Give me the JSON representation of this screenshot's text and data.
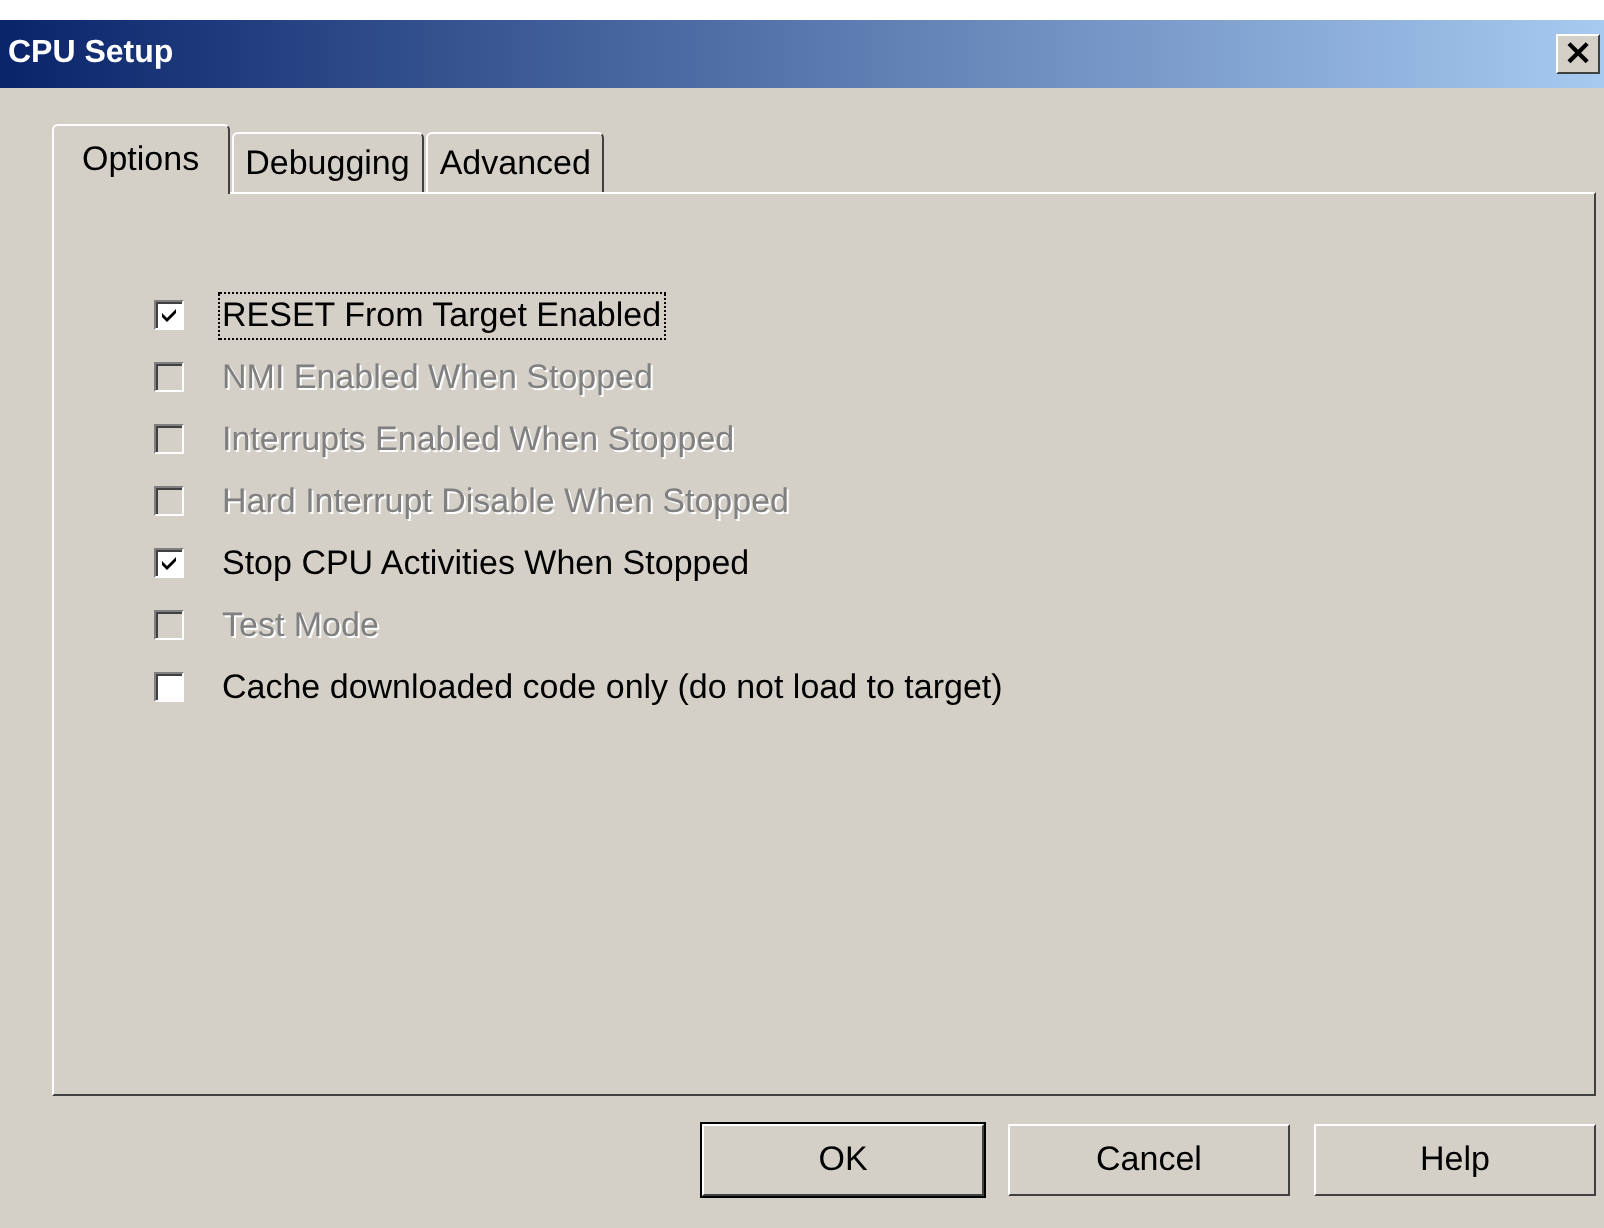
{
  "window": {
    "title": "CPU Setup",
    "close": "×"
  },
  "tabs": [
    {
      "label": "Options",
      "selected": true
    },
    {
      "label": "Debugging",
      "selected": false
    },
    {
      "label": "Advanced",
      "selected": false
    }
  ],
  "options": [
    {
      "label": "RESET From Target Enabled",
      "checked": true,
      "disabled": false,
      "focused": true
    },
    {
      "label": "NMI Enabled When Stopped",
      "checked": false,
      "disabled": true,
      "focused": false
    },
    {
      "label": "Interrupts Enabled When Stopped",
      "checked": false,
      "disabled": true,
      "focused": false
    },
    {
      "label": "Hard Interrupt Disable When Stopped",
      "checked": false,
      "disabled": true,
      "focused": false
    },
    {
      "label": "Stop CPU Activities When Stopped",
      "checked": true,
      "disabled": false,
      "focused": false
    },
    {
      "label": "Test Mode",
      "checked": false,
      "disabled": true,
      "focused": false
    },
    {
      "label": "Cache downloaded code only (do not load to target)",
      "checked": false,
      "disabled": false,
      "focused": false
    }
  ],
  "buttons": [
    {
      "label": "OK",
      "default": true
    },
    {
      "label": "Cancel",
      "default": false
    },
    {
      "label": "Help",
      "default": false
    }
  ]
}
